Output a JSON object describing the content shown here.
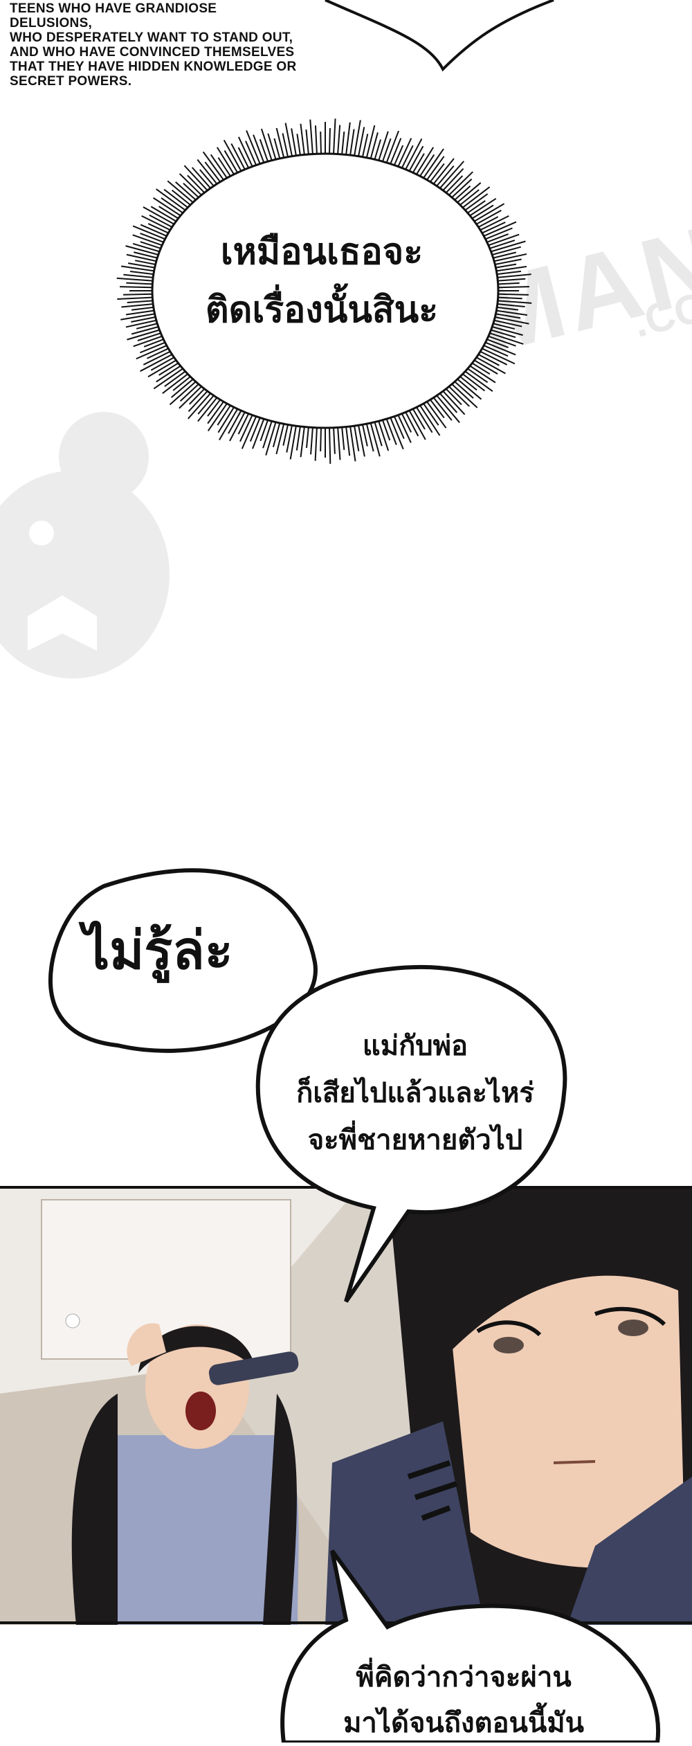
{
  "caption": "TEENS WHO HAVE GRANDIOSE DELUSIONS,\nWHO DESPERATELY WANT TO STAND OUT,\nAND WHO HAVE CONVINCED THEMSELVES\nTHAT THEY HAVE HIDDEN KNOWLEDGE OR\nSECRET POWERS.",
  "watermark": {
    "text": "KAPIMANGA",
    "suffix": ".CO"
  },
  "bubbles": {
    "spiky": "เหมือนเธอจะ\nติดเรื่องนั้นสินะ",
    "big": "ไม่รู้ล่ะ",
    "mid": "แม่กับพ่อ\nก็เสียไปแล้วและไหร่\nจะพี่ชายหายตัวไป",
    "bottom": "พี่คิดว่ากว่าจะผ่าน\nมาได้จนถึงตอนนี้มัน"
  },
  "colors": {
    "ink": "#111111",
    "panel_wall": "#d9d2c8",
    "hair": "#1d1a1c",
    "shirt": "#9aa3c4",
    "skin": "#f0cdb5",
    "coat": "#3d4360"
  }
}
